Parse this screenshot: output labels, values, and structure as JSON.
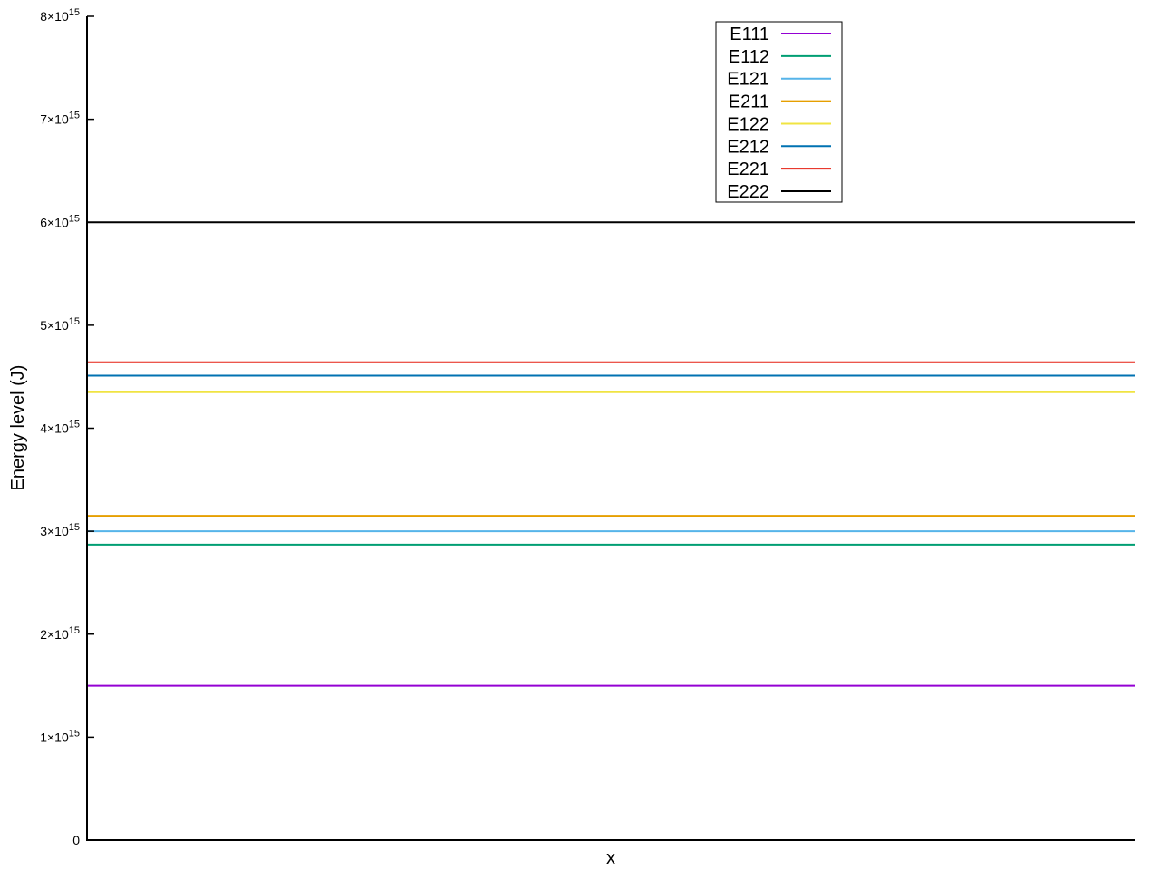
{
  "chart_data": {
    "type": "line",
    "xlabel": "x",
    "ylabel": "Energy level (J)",
    "ylim": [
      0,
      8000000000000000.0
    ],
    "y_ticks": [
      {
        "value": 0,
        "mantissa": "0",
        "exp": ""
      },
      {
        "value": 1000000000000000.0,
        "mantissa": "1×10",
        "exp": "15"
      },
      {
        "value": 2000000000000000.0,
        "mantissa": "2×10",
        "exp": "15"
      },
      {
        "value": 3000000000000000.0,
        "mantissa": "3×10",
        "exp": "15"
      },
      {
        "value": 4000000000000000.0,
        "mantissa": "4×10",
        "exp": "15"
      },
      {
        "value": 5000000000000000.0,
        "mantissa": "5×10",
        "exp": "15"
      },
      {
        "value": 6000000000000000.0,
        "mantissa": "6×10",
        "exp": "15"
      },
      {
        "value": 7000000000000000.0,
        "mantissa": "7×10",
        "exp": "15"
      },
      {
        "value": 8000000000000000.0,
        "mantissa": "8×10",
        "exp": "15"
      }
    ],
    "grid": false,
    "legend_position": "top-right",
    "series": [
      {
        "name": "E111",
        "value": 1500000000000000.0,
        "color": "#9400d3"
      },
      {
        "name": "E112",
        "value": 2870000000000000.0,
        "color": "#009e73"
      },
      {
        "name": "E121",
        "value": 3000000000000000.0,
        "color": "#56b4e9"
      },
      {
        "name": "E211",
        "value": 3150000000000000.0,
        "color": "#e69f00"
      },
      {
        "name": "E122",
        "value": 4350000000000000.0,
        "color": "#f0e442"
      },
      {
        "name": "E212",
        "value": 4510000000000000.0,
        "color": "#0072b2"
      },
      {
        "name": "E221",
        "value": 4640000000000000.0,
        "color": "#e51e10"
      },
      {
        "name": "E222",
        "value": 6000000000000000.0,
        "color": "#000000"
      }
    ]
  }
}
